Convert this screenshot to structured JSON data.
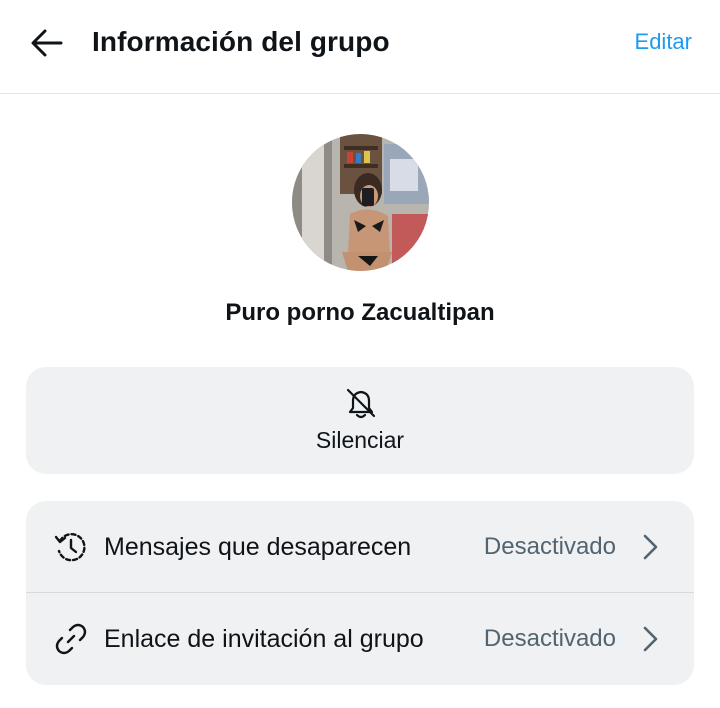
{
  "header": {
    "back_icon": "arrow-left-icon",
    "title": "Información del grupo",
    "edit_label": "Editar"
  },
  "group": {
    "avatar": "group-avatar-photo",
    "name": "Puro porno Zacualtipan"
  },
  "mute": {
    "icon": "bell-off-icon",
    "label": "Silenciar"
  },
  "settings": {
    "rows": [
      {
        "icon": "history-clock-icon",
        "label": "Mensajes que desaparecen",
        "value": "Desactivado",
        "chevron": "chevron-right-icon"
      },
      {
        "icon": "link-icon",
        "label": "Enlace de invitación al grupo",
        "value": "Desactivado",
        "chevron": "chevron-right-icon"
      }
    ]
  },
  "colors": {
    "accent": "#1d9bf0",
    "text": "#0f1419",
    "secondary_text": "#536471",
    "card_bg": "#eff1f3"
  }
}
